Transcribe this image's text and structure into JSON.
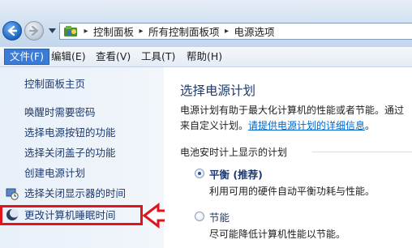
{
  "address_bar": {
    "crumbs": [
      "控制面板",
      "所有控制面板项",
      "电源选项"
    ]
  },
  "menu": {
    "items": [
      "文件(F)",
      "编辑(E)",
      "查看(V)",
      "工具(T)",
      "帮助(H)"
    ],
    "active_index": 0
  },
  "sidebar": {
    "home": "控制面板主页",
    "tasks": [
      "唤醒时需要密码",
      "选择电源按钮的功能",
      "选择关闭盖子的功能",
      "创建电源计划",
      "选择关闭显示器的时间",
      "更改计算机睡眠时间"
    ],
    "highlighted_task": "更改计算机睡眠时间"
  },
  "main": {
    "title": "选择电源计划",
    "desc_line1": "电源计划有助于最大化计算机的性能或者节能。通过",
    "desc_line2_prefix": "来自定义计划。",
    "desc_link": "请提供电源计划的详细信息",
    "desc_line2_suffix": "。",
    "section_label": "电池安时计上显示的计划",
    "plans": [
      {
        "name": "平衡 (推荐)",
        "desc": "利用可用的硬件自动平衡功耗与性能。",
        "selected": true
      },
      {
        "name": "节能",
        "desc": "尽可能降低计算机性能以节能。",
        "selected": false
      }
    ]
  },
  "colors": {
    "highlight_red": "#e0141a",
    "menu_active": "#3a7bd5",
    "link": "#0066cc",
    "heading": "#1e3a6e"
  }
}
